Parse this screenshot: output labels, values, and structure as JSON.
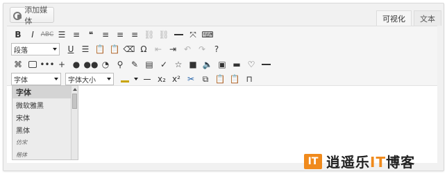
{
  "add_media": {
    "label": "添加媒体",
    "icon": "media-icon"
  },
  "tabs": [
    {
      "label": "可视化",
      "active": true
    },
    {
      "label": "文本",
      "active": false
    }
  ],
  "toolbar": {
    "format_select": "段落",
    "font_select": "字体",
    "size_select": "字体大小",
    "bold": "B",
    "italic": "I",
    "strike": "ABC",
    "omega": "Ω",
    "help": "?"
  },
  "font_dropdown": {
    "items": [
      "字体",
      "微软雅黑",
      "宋体",
      "黑体",
      "仿宋",
      "楷体"
    ],
    "selected": "字体"
  },
  "watermark": {
    "logo_text": "IT",
    "text_before": "逍遥乐",
    "text_highlight": "IT",
    "text_after": "博客"
  }
}
